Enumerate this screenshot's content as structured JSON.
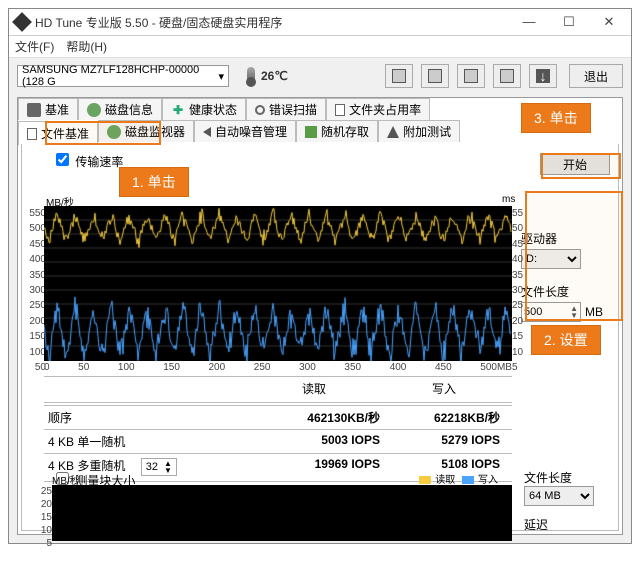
{
  "window": {
    "title": "HD Tune 专业版 5.50 - 硬盘/固态硬盘实用程序"
  },
  "menu": {
    "file": "文件(F)",
    "help": "帮助(H)"
  },
  "toolbar": {
    "device": "SAMSUNG MZ7LF128HCHP-00000 (128 G",
    "temp": "26℃",
    "exit": "退出"
  },
  "tabs_top": [
    {
      "i": "camera",
      "l": "基准"
    },
    {
      "i": "disk",
      "l": "磁盘信息"
    },
    {
      "i": "plus",
      "l": "健康状态"
    },
    {
      "i": "mag",
      "l": "错误扫描"
    },
    {
      "i": "doc",
      "l": "文件夹占用率"
    }
  ],
  "tabs_bottom": [
    {
      "i": "doc",
      "l": "文件基准"
    },
    {
      "i": "disk",
      "l": "磁盘监视器"
    },
    {
      "i": "speaker",
      "l": "自动噪音管理"
    },
    {
      "i": "chip",
      "l": "随机存取"
    },
    {
      "i": "beak",
      "l": "附加测试"
    }
  ],
  "file_bench": {
    "transfer_rate": "传输速率",
    "start": "开始",
    "driver": "驱动器",
    "drive_sel": "D:",
    "file_len": "文件长度",
    "file_len_val": "500",
    "file_len_unit": "MB",
    "y_unit": "MB/秒",
    "y_right_unit": "ms",
    "y_left": [
      "550",
      "500",
      "450",
      "400",
      "350",
      "300",
      "250",
      "200",
      "150",
      "100",
      "50"
    ],
    "y_right": [
      "55",
      "50",
      "45",
      "40",
      "35",
      "30",
      "25",
      "20",
      "15",
      "10",
      "5"
    ],
    "x_labels": [
      "0",
      "50",
      "100",
      "150",
      "200",
      "250",
      "300",
      "350",
      "400",
      "450",
      "500MB"
    ],
    "table": {
      "hdr": [
        "",
        "读取",
        "写入"
      ],
      "rows": [
        [
          "顺序",
          "462130KB/秒",
          "62218KB/秒"
        ],
        [
          "4 KB 单一随机",
          "5003 IOPS",
          "5279 IOPS"
        ],
        [
          "4 KB 多重随机",
          "19969 IOPS",
          "5108 IOPS"
        ]
      ],
      "multi_count": "32"
    }
  },
  "block_size": {
    "label": "测量块大小",
    "unit": "MB/秒",
    "y": [
      "25",
      "20",
      "15",
      "10",
      "5"
    ],
    "legend": [
      "读取",
      "写入"
    ],
    "file_len": "文件长度",
    "sel": "64 MB",
    "delay": "延迟"
  },
  "annot": {
    "a1": "1. 单击",
    "a2": "2. 设置",
    "a3": "3. 单击"
  }
}
